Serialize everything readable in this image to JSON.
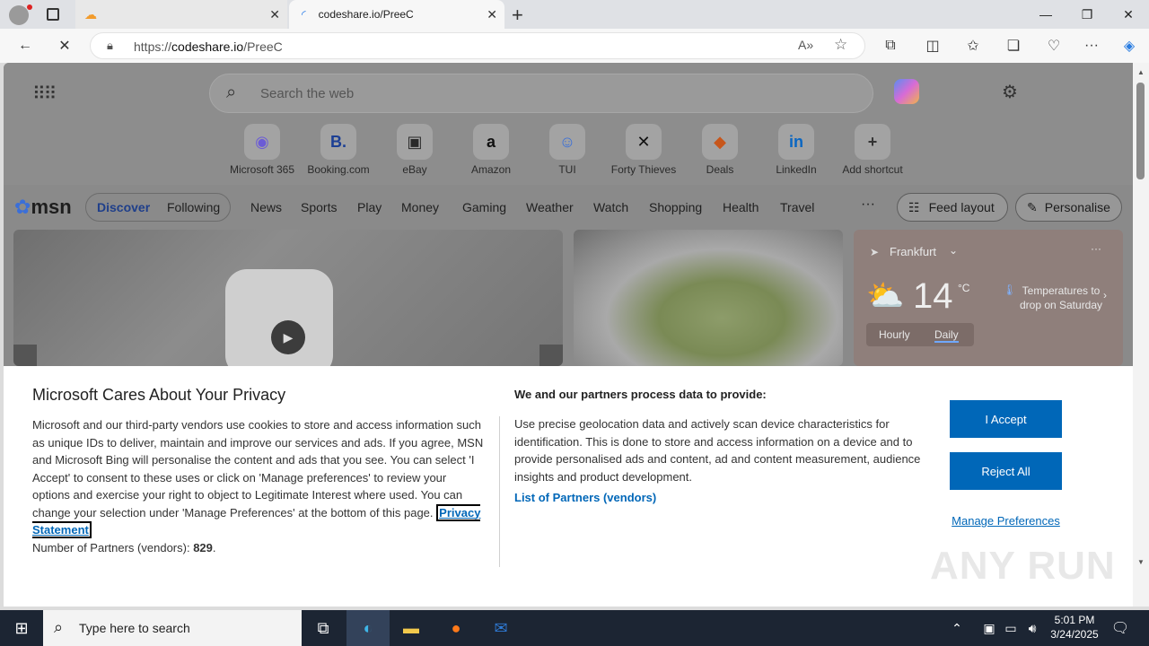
{
  "browser": {
    "tabs": [
      {
        "title": ""
      },
      {
        "title": "codeshare.io/PreeC"
      }
    ],
    "url_prefix": "https://",
    "url_domain": "codeshare.io",
    "url_path": "/PreeC"
  },
  "search": {
    "placeholder": "Search the web"
  },
  "shortcuts": [
    {
      "label": "Microsoft 365",
      "glyph": "◉",
      "color": "#6b5bd6"
    },
    {
      "label": "Booking.com",
      "glyph": "B.",
      "color": "#1c3f94"
    },
    {
      "label": "eBay",
      "glyph": "▣",
      "color": "#2a2a2a"
    },
    {
      "label": "Amazon",
      "glyph": "a",
      "color": "#111111"
    },
    {
      "label": "TUI",
      "glyph": "☺",
      "color": "#3a6fd8"
    },
    {
      "label": "Forty Thieves",
      "glyph": "✕",
      "color": "#111111"
    },
    {
      "label": "Deals",
      "glyph": "◆",
      "color": "#c7561b"
    },
    {
      "label": "LinkedIn",
      "glyph": "in",
      "color": "#0a66c2"
    },
    {
      "label": "Add shortcut",
      "glyph": "+",
      "color": "#333333"
    }
  ],
  "msn": {
    "logo": "msn",
    "tabs": [
      "Discover",
      "Following"
    ],
    "nav": [
      "News",
      "Sports",
      "Play",
      "Money",
      "Gaming",
      "Weather",
      "Watch",
      "Shopping",
      "Health",
      "Travel"
    ],
    "more": "···",
    "feed_layout": "Feed layout",
    "personalise": "Personalise"
  },
  "weather": {
    "city": "Frankfurt",
    "temp": "14",
    "unit": "°C",
    "note": "Temperatures to drop on Saturday",
    "tabs": [
      "Hourly",
      "Daily"
    ]
  },
  "privacy": {
    "title": "Microsoft Cares About Your Privacy",
    "body": "Microsoft and our third-party vendors use cookies to store and access information such as unique IDs to deliver, maintain and improve our services and ads. If you agree, MSN and Microsoft Bing will personalise the content and ads that you see. You can select 'I Accept' to consent to these uses or click on 'Manage preferences' to review your options and exercise your right to object to Legitimate Interest where used.  You can change your selection under 'Manage Preferences' at the bottom of this page.",
    "privacy_link": "Privacy Statement",
    "partners_label": "Number of Partners (vendors):",
    "partners_count": "829",
    "right_title": "We and our partners process data to provide:",
    "right_body": "Use precise geolocation data and actively scan device characteristics for identification. This is done to store and access information on a device and to provide personalised ads and content, ad and content measurement, audience insights and product development.",
    "vendors_link": "List of Partners (vendors)",
    "accept": "I Accept",
    "reject": "Reject All",
    "manage": "Manage Preferences"
  },
  "taskbar": {
    "search_placeholder": "Type here to search",
    "time": "5:01 PM",
    "date": "3/24/2025"
  },
  "watermark": "ANY RUN"
}
